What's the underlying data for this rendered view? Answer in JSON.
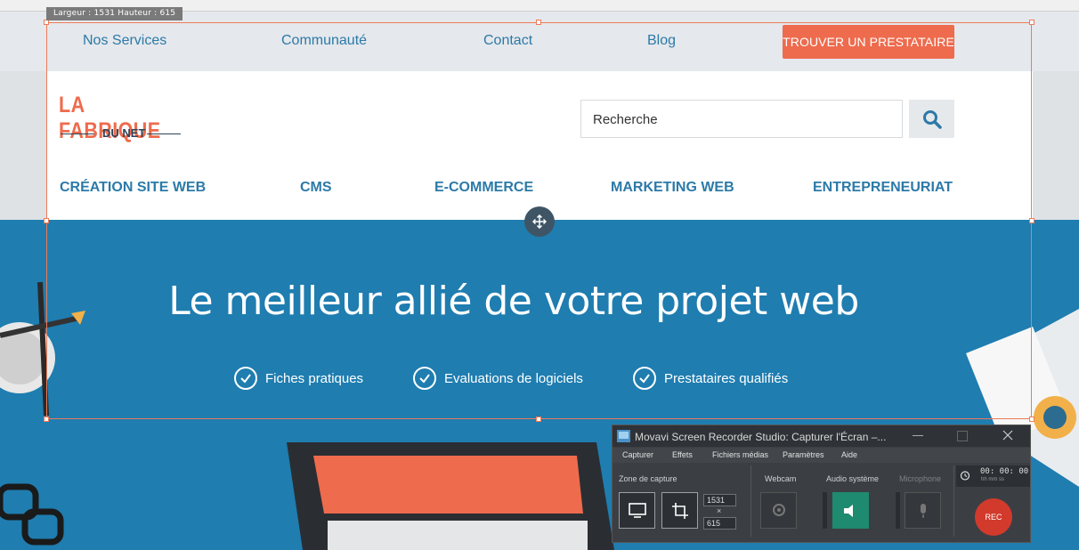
{
  "capture_size_label": "Largeur : 1531  Hauteur : 615",
  "nav": {
    "items": [
      "Nos Services",
      "Communauté",
      "Contact",
      "Blog"
    ],
    "cta": "TROUVER UN PRESTATAIRE"
  },
  "header": {
    "logo_main": "LA FABRIQUE",
    "logo_sub": "DU NET",
    "search_placeholder": "Recherche",
    "categories": [
      "CRÉATION SITE WEB",
      "CMS",
      "E-COMMERCE",
      "MARKETING WEB",
      "ENTREPRENEURIAT"
    ]
  },
  "hero": {
    "title": "Le meilleur allié de votre projet web",
    "features": [
      "Fiches pratiques",
      "Evaluations de logiciels",
      "Prestataires qualifiés"
    ]
  },
  "recorder": {
    "title": "Movavi Screen Recorder Studio: Capturer l'Écran –...",
    "menu": [
      "Capturer",
      "Effets",
      "Fichiers médias",
      "Paramètres",
      "Aide"
    ],
    "zone_label": "Zone de capture",
    "width_value": "1531",
    "height_value": "615",
    "times_sign": "×",
    "webcam_label": "Webcam",
    "audio_label": "Audio système",
    "mic_label": "Microphone",
    "timer": "00: 00: 00",
    "timer_units": "hh  mm  ss",
    "rec_label": "REC"
  },
  "colors": {
    "accent": "#ee6b4d",
    "link": "#2c7aa8",
    "hero_bg": "#1f7db0"
  }
}
